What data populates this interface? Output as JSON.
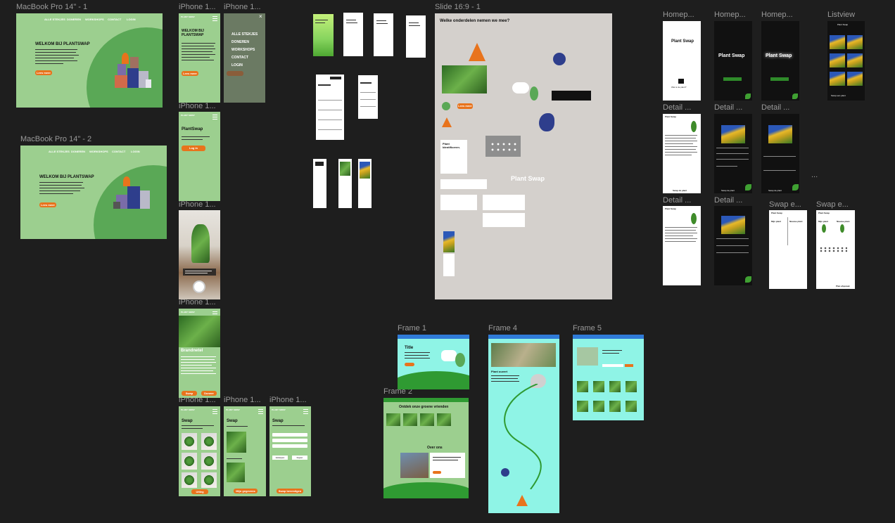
{
  "labels": {
    "mac1": "MacBook Pro 14\" - 1",
    "mac2": "MacBook Pro 14\" - 2",
    "iph_a1": "iPhone 1...",
    "iph_a2": "iPhone 1...",
    "iph_b1": "iPhone 1...",
    "iph_b2": "iPhone 1...",
    "iph_b3": "iPhone 1...",
    "iph_c1": "iPhone 1...",
    "iph_c2": "iPhone 1...",
    "iph_c3": "iPhone 1...",
    "slide": "Slide 16:9 - 1",
    "home1": "Homep...",
    "home2": "Homep...",
    "home3": "Homep...",
    "list": "Listview",
    "det1": "Detail ...",
    "det2": "Detail ...",
    "det3": "Detail ...",
    "det4": "Detail ...",
    "det5": "Detail ...",
    "swap1": "Swap e...",
    "swap2": "Swap e...",
    "f1": "Frame 1",
    "f2": "Frame 2",
    "f4": "Frame 4",
    "f5": "Frame 5",
    "dots": "..."
  },
  "mac1": {
    "nav": [
      "ALLE STEKJES",
      "DONEREN",
      "WORKSHOPS",
      "CONTACT",
      "LOGIN"
    ],
    "title": "WELKOM BIJ PLANTSWAP",
    "button": "Lees meer"
  },
  "mac2": {
    "nav": [
      "ALLE STEKJES",
      "DONEREN",
      "WORKSHOPS",
      "CONTACT",
      "LOGIN"
    ],
    "title": "WELKOM BIJ PLANTSWAP",
    "button": "Lees meer"
  },
  "phone1": {
    "logo": "PLANT SWAP",
    "title": "WELKOM BIJ PLANTSWAP",
    "button": "Lees meer"
  },
  "menu": {
    "items": [
      "ALLE STEKJES",
      "DONEREN",
      "WORKSHOPS",
      "CONTACT",
      "LOGIN"
    ],
    "close": "×"
  },
  "phone2": {
    "title": "PlantSwap",
    "button": "Log in"
  },
  "phone4": {
    "title": "Brandnetel",
    "btn1": "Swap",
    "btn2": "Doneer"
  },
  "phone5": {
    "title": "Swap",
    "button": "Uitleg"
  },
  "phone6": {
    "title": "Swap",
    "button": "Mijn gegevens"
  },
  "phone7": {
    "title": "Swap",
    "b1": "Verkopen",
    "b2": "Kopen",
    "button": "Swap bevestigen"
  },
  "slide": {
    "question": "Welke onderdelen nemen we mee?",
    "brand": "Plant Swap",
    "ident": "Plant Identificeren.",
    "button": "Lees meer"
  },
  "home": {
    "brand1": "Plant Swap",
    "cta1": "Wat is de plant?",
    "brand2": "Plant Swap",
    "brand3": "Plant Swap"
  },
  "detail": {
    "title": "Plant Swap",
    "swap": "Swap de plant"
  },
  "listview": {
    "top": "Plant Swap",
    "swap": "Swap een plant"
  },
  "swap": {
    "title": "Plant Swap",
    "mijn": "Mijn plant",
    "nieuwe": "Nieuwe plant",
    "afspraak": "Plan afspraak"
  },
  "frame1": {
    "title": "Title"
  },
  "frame2": {
    "title": "Ontdek onze groene vrienden",
    "over": "Over ons"
  },
  "frame4": {
    "title": "Plant ouvert"
  },
  "colors": {
    "green": "#9ccf8f",
    "dark_green": "#5aa856",
    "orange": "#e8731c",
    "cyan": "#8ff4e6",
    "canvas": "#1e1e1e"
  }
}
